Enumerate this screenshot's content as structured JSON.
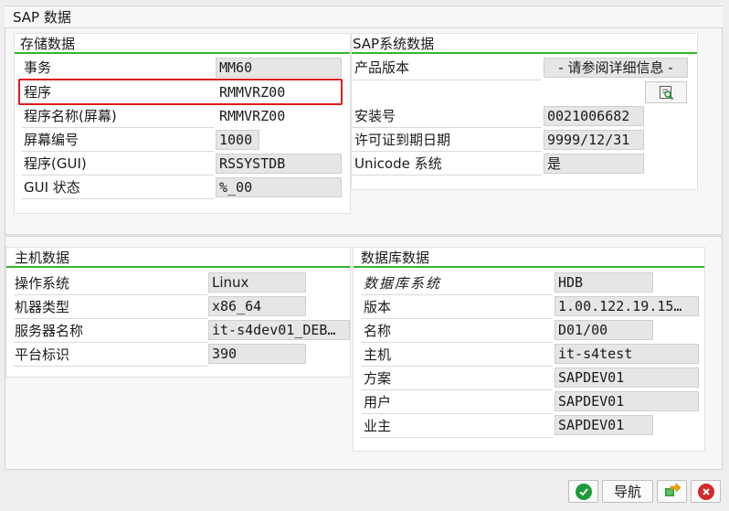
{
  "window": {
    "title": "SAP 数据"
  },
  "storage": {
    "title": "存储数据",
    "rows": [
      {
        "label": "事务",
        "value": "MM60"
      },
      {
        "label": "程序",
        "value": "RMMVRZ00"
      },
      {
        "label": "程序名称(屏幕)",
        "value": "RMMVRZ00"
      },
      {
        "label": "屏幕编号",
        "value": "1000"
      },
      {
        "label": "程序(GUI)",
        "value": "RSSYSTDB"
      },
      {
        "label": "GUI 状态",
        "value": "%_00"
      }
    ]
  },
  "sap_system": {
    "title": "SAP系统数据",
    "rows": [
      {
        "label": "产品版本",
        "value": "- 请参阅详细信息 -"
      },
      {
        "label": "安装号",
        "value": "0021006682"
      },
      {
        "label": "许可证到期日期",
        "value": "9999/12/31"
      },
      {
        "label": "Unicode 系统",
        "value": "是"
      }
    ],
    "detail_icon": "details-icon"
  },
  "host": {
    "title": "主机数据",
    "rows": [
      {
        "label": "操作系统",
        "value": "Linux"
      },
      {
        "label": "机器类型",
        "value": "x86_64"
      },
      {
        "label": "服务器名称",
        "value": "it-s4dev01_DEB…"
      },
      {
        "label": "平台标识",
        "value": "390"
      }
    ]
  },
  "database": {
    "title": "数据库数据",
    "rows": [
      {
        "label": "数据库系统",
        "value": "HDB"
      },
      {
        "label": "版本",
        "value": "1.00.122.19.15…"
      },
      {
        "label": "名称",
        "value": "D01/00"
      },
      {
        "label": "主机",
        "value": "it-s4test"
      },
      {
        "label": "方案",
        "value": "SAPDEV01"
      },
      {
        "label": "用户",
        "value": "SAPDEV01"
      },
      {
        "label": "业主",
        "value": "SAPDEV01"
      }
    ]
  },
  "footer": {
    "confirm_icon": "check-icon",
    "navigate_label": "导航",
    "transfer_icon": "transfer-icon",
    "cancel_icon": "cancel-icon"
  },
  "colors": {
    "group_underline": "#31b531",
    "highlight": "#e0191d",
    "confirm": "#1d9b3a",
    "cancel": "#d42a2a"
  }
}
